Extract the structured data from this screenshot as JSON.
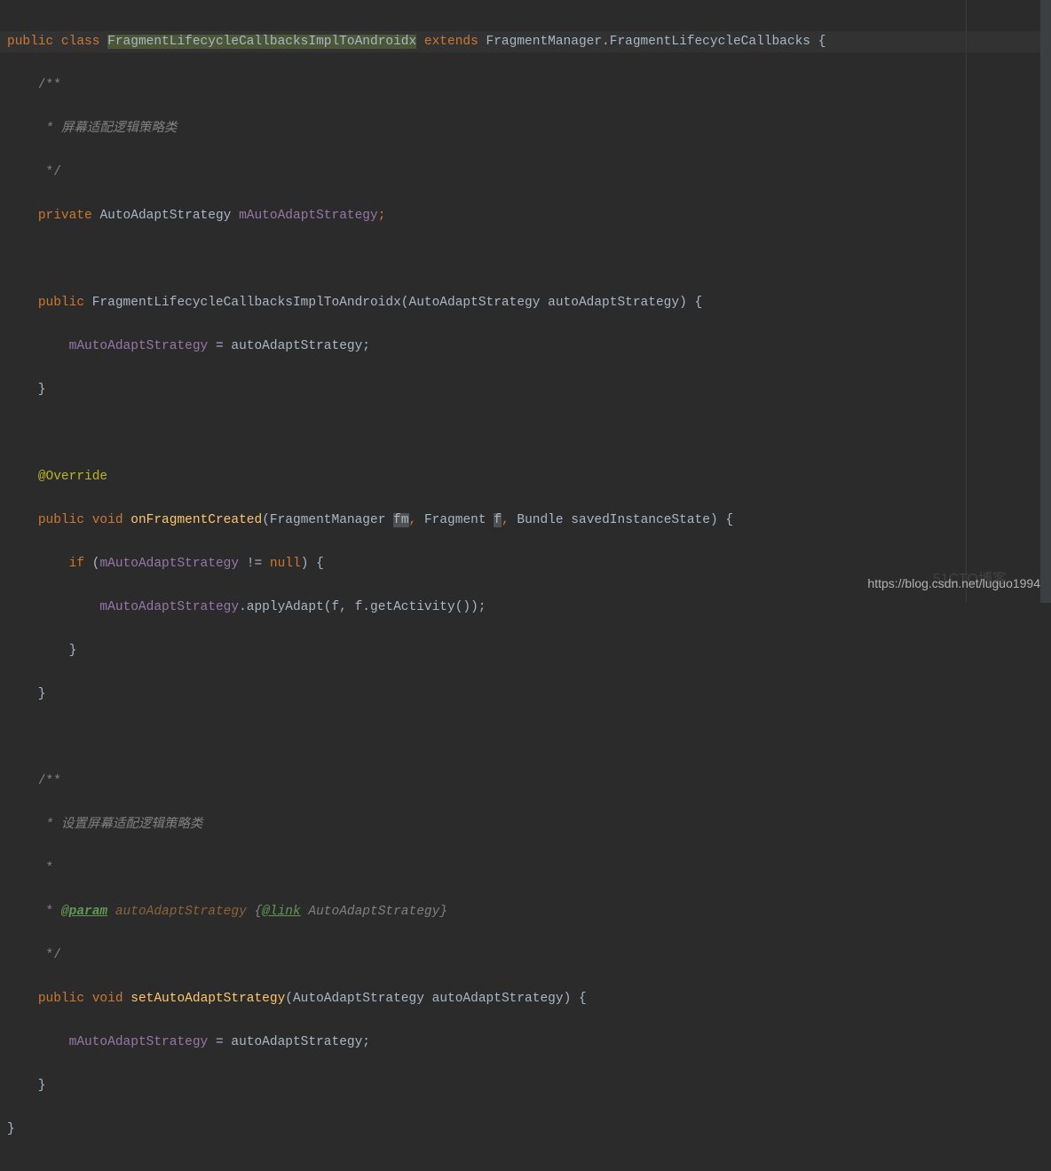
{
  "line1": {
    "public": "public",
    "class": "class",
    "classname": "FragmentLifecycleCallbacksImplToAndroidx",
    "extends": "extends",
    "parent": "FragmentManager.FragmentLifecycleCallbacks",
    "brace": " {"
  },
  "comment1": {
    "open": "/**",
    "body": " * 屏幕适配逻辑策略类",
    "close": " */"
  },
  "field": {
    "private": "private",
    "type": "AutoAdaptStrategy",
    "name": "mAutoAdaptStrategy",
    "semi": ";"
  },
  "constructor": {
    "public": "public",
    "name": "FragmentLifecycleCallbacksImplToAndroidx",
    "param_type": "AutoAdaptStrategy",
    "param_name": "autoAdaptStrategy",
    "body_field": "mAutoAdaptStrategy",
    "body_assign": " = autoAdaptStrategy;"
  },
  "override": "@Override",
  "method1": {
    "public": "public",
    "void": "void",
    "name": "onFragmentCreated",
    "p1t": "FragmentManager",
    "p1n": "fm",
    "p2t": "Fragment",
    "p2n": "f",
    "p3t": "Bundle",
    "p3n": "savedInstanceState",
    "if": "if",
    "cond_field": "mAutoAdaptStrategy",
    "cond_op": " != ",
    "null": "null",
    "call_field": "mAutoAdaptStrategy",
    "call_method": "applyAdapt",
    "call_args": "(f, f.getActivity());"
  },
  "comment2": {
    "open": "/**",
    "body1": " * 设置屏幕适配逻辑策略类",
    "body2": " *",
    "body3_pre": " * ",
    "param_tag": "@param",
    "param_name": " autoAdaptStrategy ",
    "brace_open": "{",
    "link_tag": "@link",
    "link_text": " AutoAdaptStrategy",
    "brace_close": "}",
    "close": " */"
  },
  "method2": {
    "public": "public",
    "void": "void",
    "name": "setAutoAdaptStrategy",
    "param_type": "AutoAdaptStrategy",
    "param_name": "autoAdaptStrategy",
    "body_field": "mAutoAdaptStrategy",
    "body_assign": " = autoAdaptStrategy;"
  },
  "watermark": "https://blog.csdn.net/luguo1994",
  "watermark_back": "51CTO博客"
}
